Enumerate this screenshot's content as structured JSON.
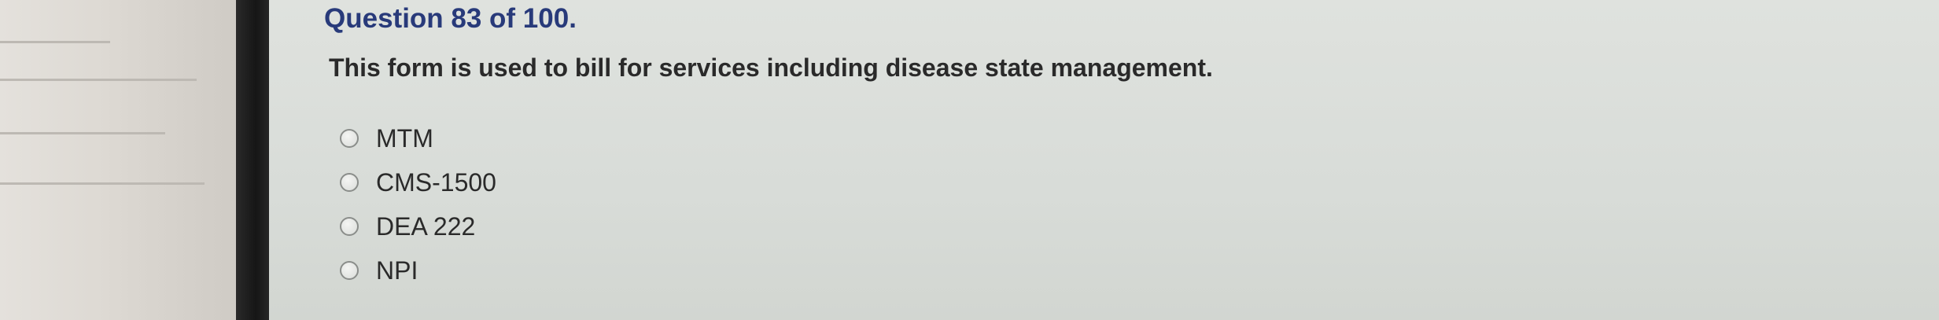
{
  "question": {
    "title": "Question 83 of 100.",
    "text": "This form is used to bill for services including disease state management.",
    "options": [
      {
        "label": "MTM",
        "selected": false
      },
      {
        "label": "CMS-1500",
        "selected": false
      },
      {
        "label": "DEA 222",
        "selected": false
      },
      {
        "label": "NPI",
        "selected": false
      }
    ]
  }
}
